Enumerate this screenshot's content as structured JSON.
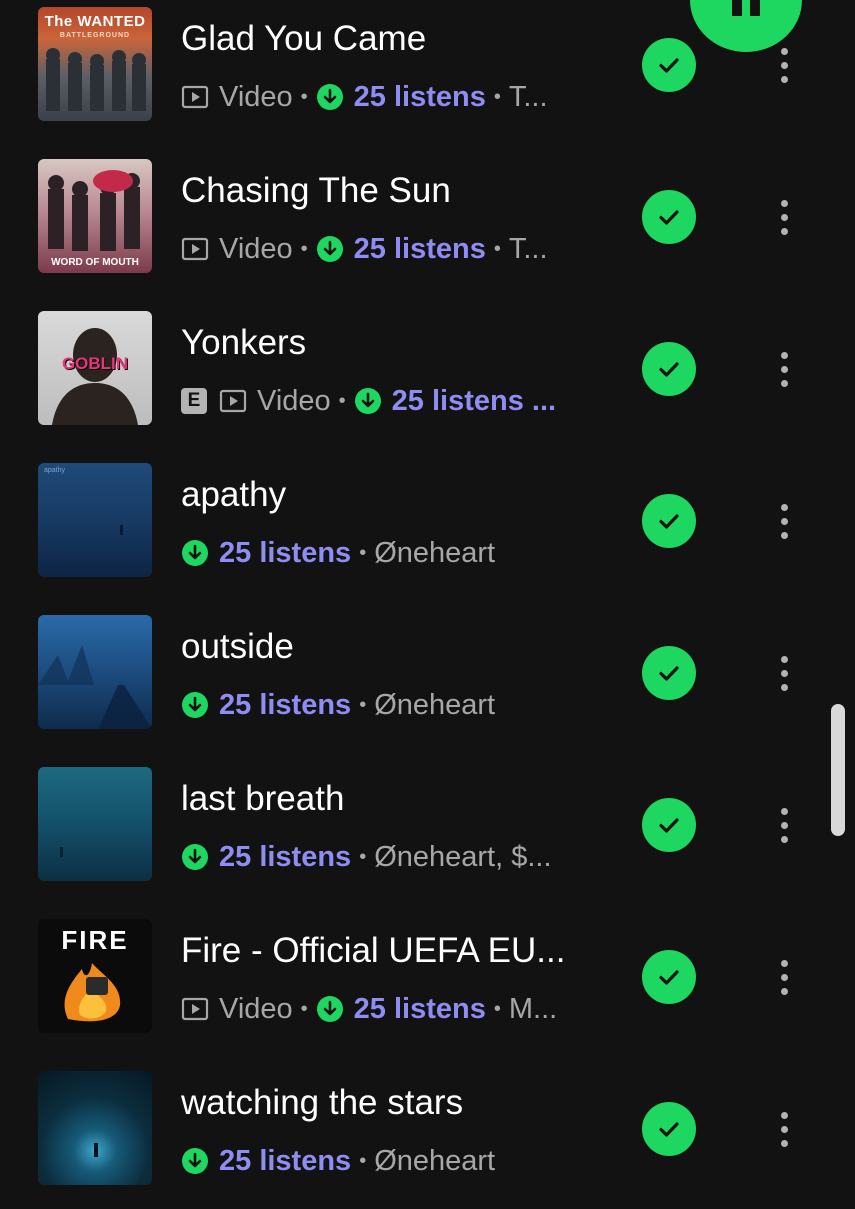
{
  "colors": {
    "background": "#121212",
    "accent_green": "#1ed760",
    "listens_purple": "#8f8df3",
    "secondary_text": "#a7a7a7"
  },
  "player": {
    "pause_icon": "pause-icon"
  },
  "tracks": [
    {
      "title": "Glad You Came",
      "explicit": false,
      "video_label": "Video",
      "listens": "25 listens",
      "tail": "T...",
      "art_text": "The WANTED",
      "art_subtext": "BATTLEGROUND"
    },
    {
      "title": "Chasing The Sun",
      "explicit": false,
      "video_label": "Video",
      "listens": "25 listens",
      "tail": "T...",
      "art_text": "WORD OF MOUTH"
    },
    {
      "title": "Yonkers",
      "explicit": true,
      "explicit_label": "E",
      "video_label": "Video",
      "listens": "25 listens ...",
      "art_text": "GOBLIN"
    },
    {
      "title": "apathy",
      "listens": "25 listens",
      "tail": "Øneheart",
      "art_text": "apathy"
    },
    {
      "title": "outside",
      "listens": "25 listens",
      "tail": "Øneheart"
    },
    {
      "title": "last breath",
      "listens": "25 listens",
      "tail": "Øneheart, $..."
    },
    {
      "title": "Fire - Official UEFA EU...",
      "video_label": "Video",
      "listens": "25 listens",
      "tail": "M...",
      "art_text": "FIRE"
    },
    {
      "title": "watching the stars",
      "listens": "25 listens",
      "tail": "Øneheart"
    }
  ]
}
